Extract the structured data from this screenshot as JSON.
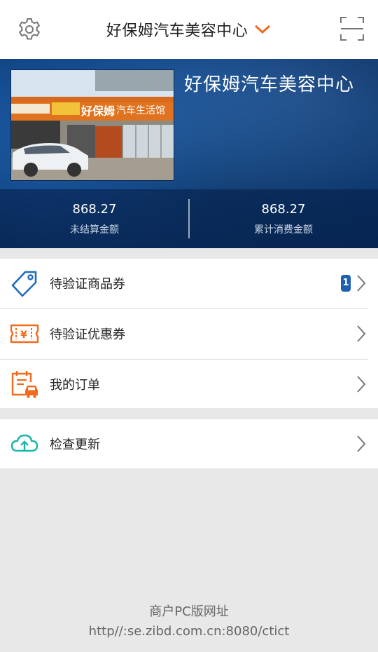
{
  "header": {
    "title": "好保姆汽车美容中心",
    "settings_icon": "gear-icon",
    "dropdown_icon": "chevron-down-icon",
    "scan_icon": "scan-icon",
    "accent_color": "#f26b1d"
  },
  "banner": {
    "shop_name": "好保姆汽车美容中心",
    "photo_sign_text": "汽车生活馆",
    "photo_logo_text": "好保姆",
    "stats": [
      {
        "value": "868.27",
        "label": "未结算金额"
      },
      {
        "value": "868.27",
        "label": "累计消费金额"
      }
    ]
  },
  "menu": {
    "group1": [
      {
        "label": "待验证商品券",
        "icon": "tag-icon",
        "badge": "1"
      },
      {
        "label": "待验证优惠券",
        "icon": "coupon-icon"
      },
      {
        "label": "我的订单",
        "icon": "order-car-icon"
      }
    ],
    "group2": [
      {
        "label": "检查更新",
        "icon": "cloud-upload-icon"
      }
    ]
  },
  "footer": {
    "label": "商户PC版网址",
    "url": "http//:se.zibd.com.cn:8080/ctict"
  }
}
